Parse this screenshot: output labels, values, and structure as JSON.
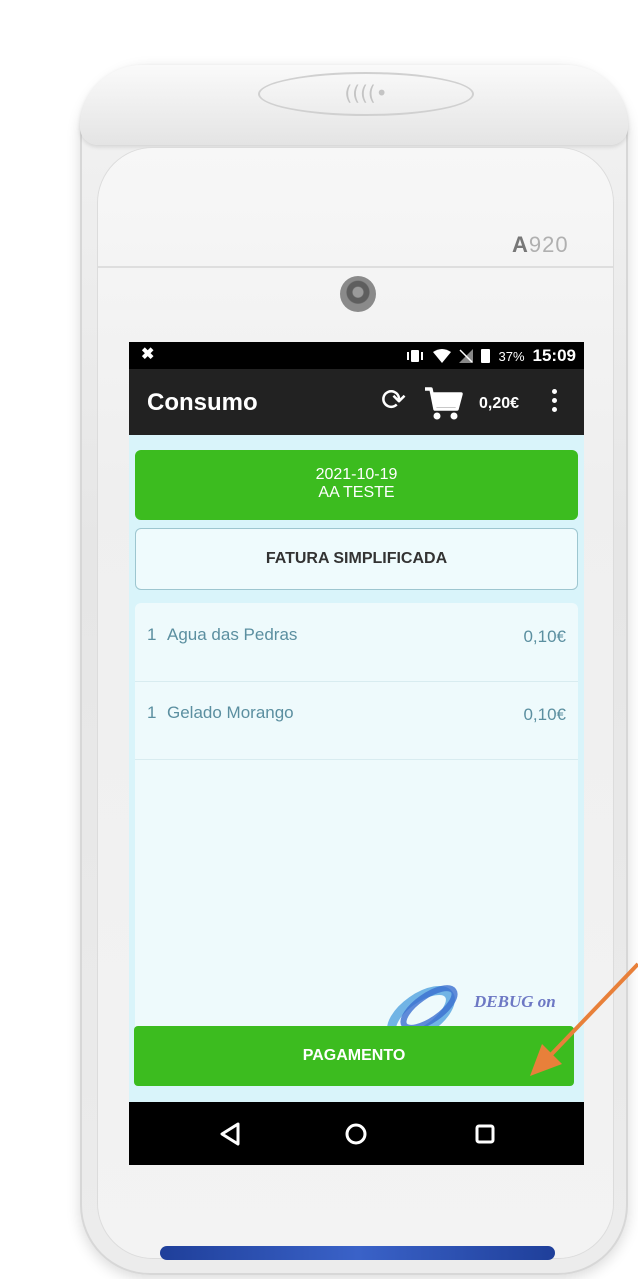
{
  "device": {
    "model_prefix": "A",
    "model_number": "920",
    "nfc_symbol": "((((•"
  },
  "status_bar": {
    "left_icon": "✖",
    "battery_percent": "37%",
    "time": "15:09",
    "icons": [
      "vibrate-icon",
      "wifi-icon",
      "no-sim-icon",
      "battery-icon"
    ]
  },
  "app_bar": {
    "title": "Consumo",
    "sync_icon": "sync-icon",
    "cart_icon": "cart-icon",
    "total": "0,20€",
    "menu_icon": "more-vert-icon"
  },
  "header_card": {
    "date": "2021-10-19",
    "client": "AA TESTE",
    "color": "#3cbc1f"
  },
  "document_type": "FATURA SIMPLIFICADA",
  "items": [
    {
      "qty": "1",
      "name": "Agua das Pedras",
      "price": "0,10€"
    },
    {
      "qty": "1",
      "name": "Gelado Morango",
      "price": "0,10€"
    }
  ],
  "watermark": {
    "text": "DEBUG on"
  },
  "pay_button": {
    "label": "PAGAMENTO",
    "color": "#3cbc1f"
  },
  "nav_bar": {
    "back_icon": "back-icon",
    "home_icon": "home-icon",
    "recents_icon": "recents-icon"
  },
  "annotation_color": "#e8803a"
}
